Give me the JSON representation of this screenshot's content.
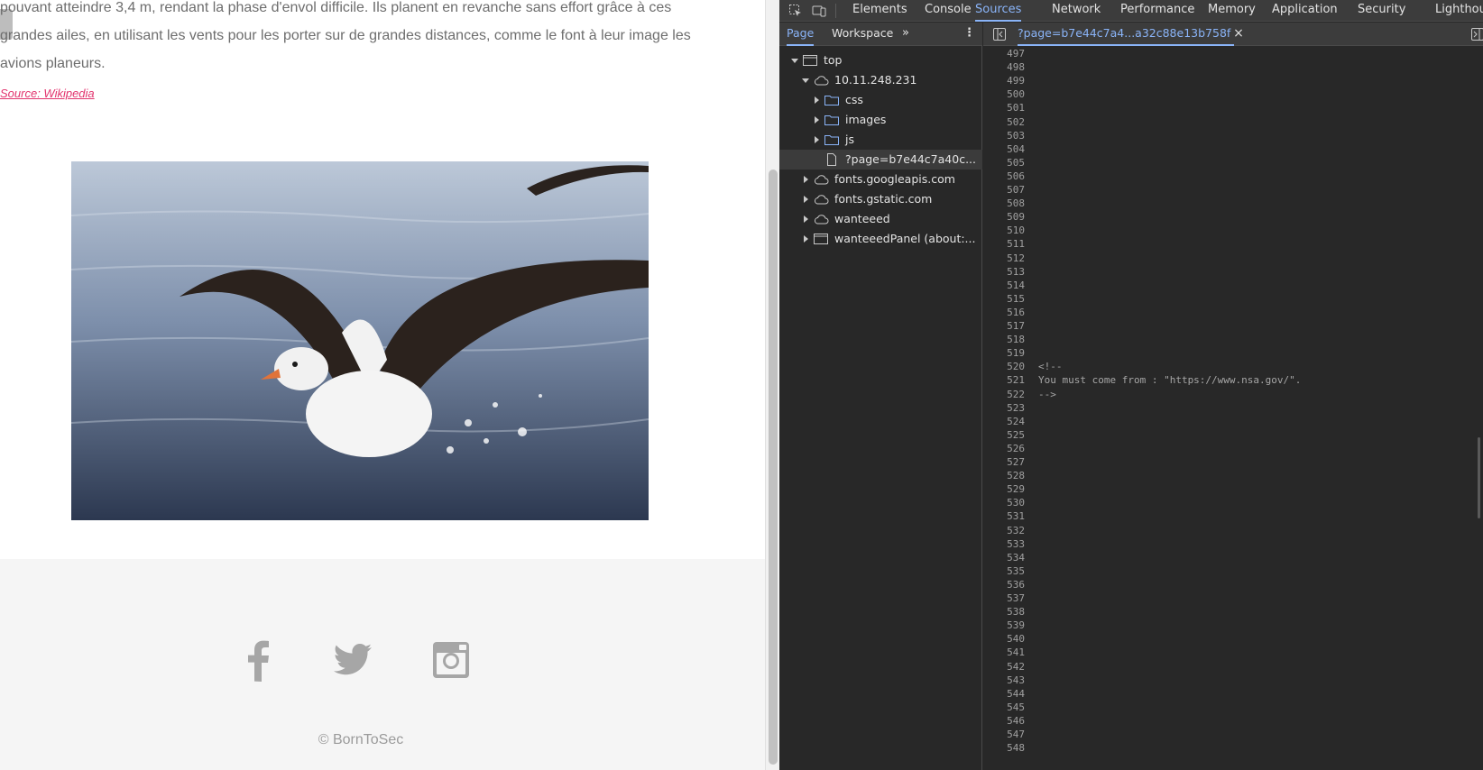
{
  "page": {
    "paragraph_lines": [
      "pouvant atteindre 3,4 m, rendant la phase d'envol difficile. Ils planent en revanche sans effort grâce à ces",
      "grandes ailes, en utilisant les vents pour les porter sur de grandes distances, comme le font à leur image les",
      "avions planeurs."
    ],
    "source_link": "Source: Wikipedia",
    "footer": {
      "social_icons": [
        "facebook-icon",
        "twitter-icon",
        "instagram-icon"
      ],
      "copyright": "© BornToSec"
    }
  },
  "devtools": {
    "tabs": [
      "Elements",
      "Console",
      "Sources",
      "Network",
      "Performance",
      "Memory",
      "Application",
      "Security",
      "Lighthouse"
    ],
    "active_tab": "Sources",
    "navigator": {
      "subtabs": [
        "Page",
        "Workspace"
      ],
      "active_subtab": "Page",
      "tree": [
        {
          "label": "top",
          "icon": "frame-icon",
          "expanded": true
        },
        {
          "label": "10.11.248.231",
          "icon": "cloud-icon",
          "expanded": true
        },
        {
          "label": "css",
          "icon": "folder-icon",
          "expanded": false
        },
        {
          "label": "images",
          "icon": "folder-icon",
          "expanded": false
        },
        {
          "label": "js",
          "icon": "folder-icon",
          "expanded": false
        },
        {
          "label": "?page=b7e44c7a40c...",
          "icon": "file-icon",
          "selected": true
        },
        {
          "label": "fonts.googleapis.com",
          "icon": "cloud-icon",
          "expanded": false
        },
        {
          "label": "fonts.gstatic.com",
          "icon": "cloud-icon",
          "expanded": false
        },
        {
          "label": "wanteeed",
          "icon": "cloud-icon",
          "expanded": false
        },
        {
          "label": "wanteeedPanel (about:...",
          "icon": "frame-icon",
          "expanded": false
        }
      ]
    },
    "editor": {
      "open_file": "?page=b7e44c7a4...a32c88e13b758f",
      "close_glyph": "×",
      "line_start": 497,
      "line_end": 548,
      "code": {
        "520": "<!--",
        "521": "You must come from : \"https://www.nsa.gov/\".",
        "522": "-->"
      }
    }
  },
  "colors": {
    "link": "#e2346e",
    "devtools_bg": "#282828",
    "devtools_accent": "#8ab4f8",
    "footer_bg": "#f5f5f5"
  }
}
